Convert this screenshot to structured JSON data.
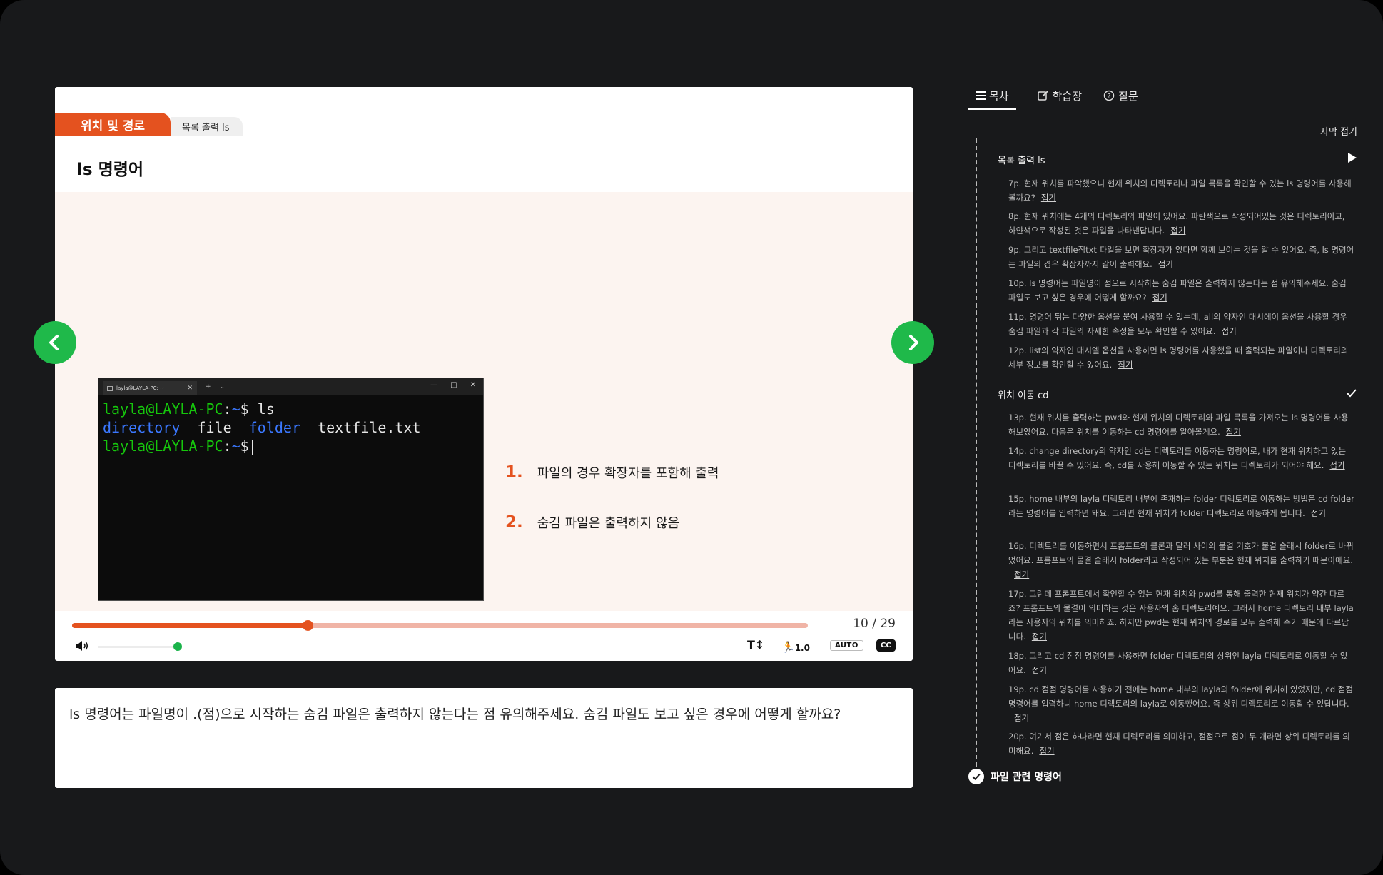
{
  "slide": {
    "section_tab": "위치 및 경로",
    "subsection_tab": "목록 출력 ls",
    "title": "ls 명령어",
    "terminal": {
      "tab_title": "layla@LAYLA-PC: ~",
      "new_tab": "+",
      "dropdown": "⌄",
      "minimize": "—",
      "maximize": "□",
      "close": "✕",
      "line1_prompt": "layla@LAYLA-PC",
      "line1_colon": ":",
      "line1_path": "~",
      "line1_cmd": "$ ls",
      "line2_dir1": "directory",
      "line2_file1": "file",
      "line2_dir2": "folder",
      "line2_file2": "textfile.txt",
      "line3_prompt": "layla@LAYLA-PC",
      "line3_colon": ":",
      "line3_path": "~",
      "line3_cmd": "$"
    },
    "points": [
      {
        "num": "1.",
        "text": "파일의 경우 확장자를 포함해 출력"
      },
      {
        "num": "2.",
        "text": "숨김 파일은 출력하지 않음"
      }
    ]
  },
  "player": {
    "progress": 0.32,
    "page_counter": "10 / 29",
    "volume": 0.9,
    "text_size_label": "T↕",
    "speed_label": "1.0",
    "auto_label": "AUTO",
    "cc_label": "CC",
    "accent_color": "#e4521f",
    "nav_color": "#1fb94a"
  },
  "caption": {
    "text": "ls 명령어는 파일명이 .(점)으로 시작하는 숨김 파일은 출력하지 않는다는 점 유의해주세요. 숨김 파일도 보고 싶은 경우에 어떻게 할까요?"
  },
  "sidebar": {
    "tabs": [
      {
        "label": "목차",
        "icon": "list-icon"
      },
      {
        "label": "학습장",
        "icon": "note-edit-icon"
      },
      {
        "label": "질문",
        "icon": "question-icon"
      }
    ],
    "collapse_captions": "자막 접기",
    "fold_label": "접기",
    "sections": [
      {
        "title": "목록 출력 ls",
        "items": [
          "7p. 현재 위치를 파악했으니 현재 위치의 디렉토리나 파일 목록을 확인할 수 있는 ls 명령어를 사용해볼까요?",
          "8p. 현재 위치에는 4개의 디렉토리와 파일이 있어요. 파란색으로 작성되어있는 것은 디렉토리이고, 하얀색으로 작성된 것은 파일을 나타낸답니다.",
          "9p. 그리고 textfile점txt 파일을 보면 확장자가 있다면 함께 보이는 것을 알 수 있어요. 즉, ls 명령어는 파일의 경우 확장자까지 같이 출력해요.",
          "10p. ls 명령어는 파일명이 점으로 시작하는 숨김 파일은 출력하지 않는다는 점 유의해주세요. 숨김 파일도 보고 싶은 경우에 어떻게 할까요?",
          "11p. 명령어 뒤는 다양한 옵션을 붙여 사용할 수 있는데, all의 약자인 대시에이 옵션을 사용할 경우 숨김 파일과 각 파일의 자세한 속성을 모두 확인할 수 있어요.",
          "12p. list의 약자인 대시엘 옵션을 사용하면 ls 명령어를 사용했을 때 출력되는 파일이나 디렉토리의 세부 정보를 확인할 수 있어요."
        ]
      },
      {
        "title": "위치 이동 cd",
        "items": [
          "13p. 현재 위치를 출력하는 pwd와 현재 위치의 디렉토리와 파일 목록을 가져오는 ls 명령어를 사용해보았어요. 다음은 위치를 이동하는 cd 명령어를 알아볼게요.",
          "14p. change directory의 약자인 cd는 디렉토리를 이동하는 명령어로, 내가 현재 위치하고 있는 디렉토리를 바꿀 수 있어요. 즉, cd를 사용해 이동할 수 있는 위치는 디렉토리가 되어야 해요.",
          "15p. home 내부의 layla 디렉토리 내부에 존재하는 folder 디렉토리로 이동하는 방법은 cd folder라는 명령어를 입력하면 돼요. 그러면 현재 위치가 folder 디렉토리로 이동하게 됩니다.",
          "16p. 디렉토리를 이동하면서 프롬프트의 콜론과 달러 사이의 물결 기호가 물결 슬래시 folder로 바뀌었어요. 프롬프트의 물결 슬래시 folder라고 작성되어 있는 부분은 현재 위치를 출력하기 때문이에요.",
          "17p. 그런데 프롬프트에서 확인할 수 있는 현재 위치와 pwd를 통해 출력한 현재 위치가 약간 다르죠? 프롬프트의 물결이 의미하는 것은 사용자의 홈 디렉토리예요. 그래서 home 디렉토리 내부 layla라는 사용자의 위치를 의미하죠. 하지만 pwd는 현재 위치의 경로를 모두 출력해 주기 때문에 다르답니다.",
          "18p. 그리고 cd 점점 명령어를 사용하면 folder 디렉토리의 상위인 layla 디렉토리로 이동할 수 있어요.",
          "19p. cd 점점 명령어를 사용하기 전에는 home 내부의 layla의 folder에 위치해 있었지만, cd 점점 명령어를 입력하니 home 디렉토리의 layla로 이동했어요. 즉 상위 디렉토리로 이동할 수 있답니다.",
          "20p. 여기서 점은 하나라면 현재 디렉토리를 의미하고, 점점으로 점이 두 개라면 상위 디렉토리를 의미해요."
        ]
      }
    ],
    "next_section": "파일 관련 명령어"
  }
}
